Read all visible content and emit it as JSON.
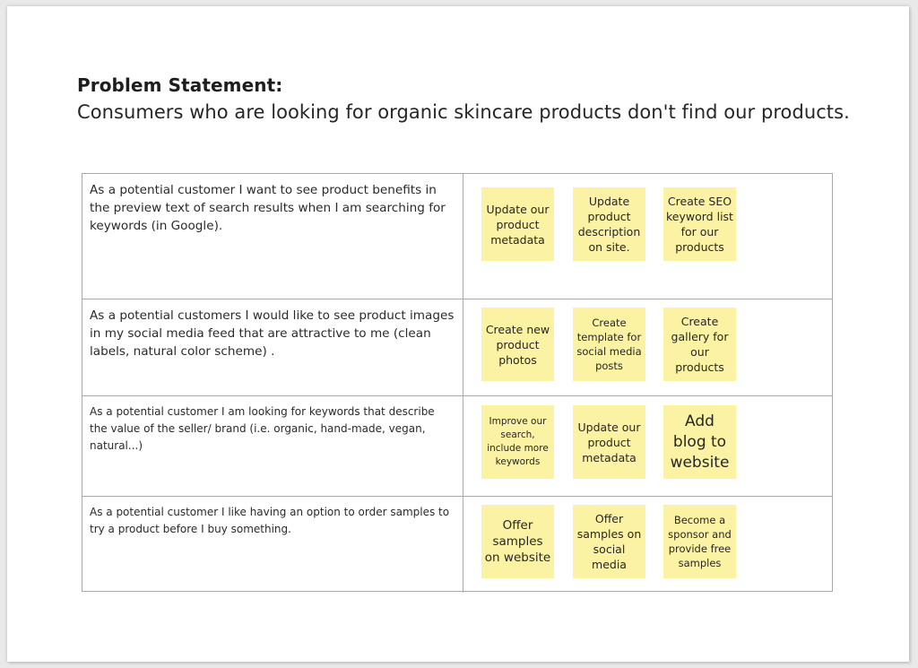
{
  "document": {
    "problem_statement_label": "Problem Statement:",
    "problem_statement_text": "Consumers who are looking for organic skincare products don't find our products."
  },
  "board": {
    "rows": [
      {
        "story": "As a potential customer I want to see product benefits in the preview text of search results when I am searching for keywords (in Google).",
        "notes": [
          "Update our product metadata",
          "Update product description on site.",
          "Create SEO keyword list for our products"
        ]
      },
      {
        "story": "As a potential customers I would like to see product images in my social media feed that are attractive to me (clean labels, natural color scheme) .",
        "notes": [
          "Create new product photos",
          "Create template for social media posts",
          "Create gallery for our products"
        ]
      },
      {
        "story": "As a potential customer I am looking for keywords that describe the value of the seller/ brand (i.e. organic, hand-made, vegan, natural...)",
        "notes": [
          "Improve our search, include more keywords",
          "Update our product metadata",
          "Add blog to website"
        ]
      },
      {
        "story": "As a potential customer I like having an option to order samples to try a product before I buy something.",
        "notes": [
          "Offer samples on website",
          "Offer samples on social media",
          "Become a sponsor and provide free samples"
        ]
      }
    ]
  },
  "colors": {
    "sticky_note": "#fbf3a3",
    "table_border": "#a9a9a9",
    "background": "#e9e9e9",
    "sheet": "#ffffff"
  }
}
